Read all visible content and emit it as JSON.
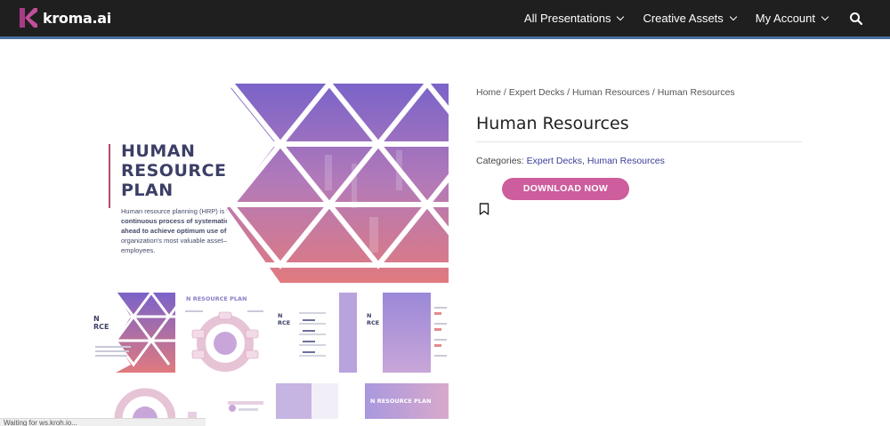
{
  "header": {
    "logo_text": "kroma.ai",
    "nav": [
      {
        "label": "All Presentations"
      },
      {
        "label": "Creative Assets"
      },
      {
        "label": "My Account"
      }
    ]
  },
  "hero": {
    "title_lines": [
      "HUMAN",
      "RESOURCE",
      "PLAN"
    ],
    "description_parts": [
      "Human resource planning (HRP) is ",
      "the continuous process of systematic planning ahead to achieve optimum use of",
      " an organization's most valuable asset—quality employees."
    ]
  },
  "thumbs": {
    "t1_title": "N",
    "t1_sub": "RCE",
    "t2_title": "N RESOURCE PLAN",
    "t3_title": "N",
    "t3_sub": "RCE",
    "t4_title": "N",
    "t4_sub": "RCE",
    "t5_title": "N RESOURCE PLAN"
  },
  "breadcrumb": {
    "items": [
      "Home",
      "Expert Decks",
      "Human Resources",
      "Human Resources"
    ],
    "separator": " / "
  },
  "product": {
    "title": "Human Resources",
    "categories_label": "Categories:",
    "categories": [
      "Expert Decks",
      "Human Resources"
    ],
    "download_label": "DOWNLOAD NOW"
  },
  "status": {
    "text": "Waiting for ws.kroh.io..."
  },
  "colors": {
    "header_bg": "#1f1f1f",
    "accent_pink": "#cd5d9c",
    "link_blue": "#3b3f9a",
    "logo_purple": "#a83b86"
  },
  "icons": {
    "search": "search-icon",
    "bookmark": "bookmark-icon",
    "chevron": "chevron-down-icon"
  }
}
